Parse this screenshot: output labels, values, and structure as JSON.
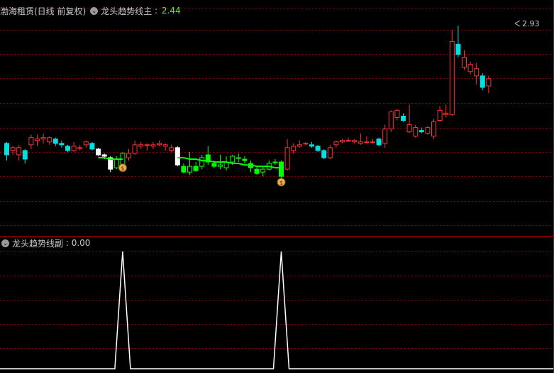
{
  "main_header": {
    "stock_name": "渤海租赁(日线 前复权)",
    "indicator_name": "龙头趋势线主",
    "indicator_value": "2.44",
    "value_color": "#33ff33"
  },
  "sub_header": {
    "indicator_name": "龙头趋势线副",
    "indicator_value": "0.00"
  },
  "price_marker": "2.93",
  "colors": {
    "up": "#ff3232",
    "down": "#00e0e0",
    "trend_up": "#ffffff",
    "trend_down": "#00ff00",
    "grid": "#8b0000",
    "signal": "#ffffff"
  },
  "chart_data": [
    {
      "type": "candlestick",
      "ylim": [
        1.5,
        3.0
      ],
      "last_high_label": "2.93",
      "candles": [
        {
          "o": 2.03,
          "c": 2.11,
          "h": 2.12,
          "l": 1.99,
          "s": "down"
        },
        {
          "o": 2.06,
          "c": 2.08,
          "h": 2.09,
          "l": 2.03,
          "s": "up"
        },
        {
          "o": 2.03,
          "c": 2.08,
          "h": 2.1,
          "l": 1.99,
          "s": "up"
        },
        {
          "o": 2.06,
          "c": 2.0,
          "h": 2.07,
          "l": 1.97,
          "s": "down"
        },
        {
          "o": 2.1,
          "c": 2.15,
          "h": 2.17,
          "l": 2.07,
          "s": "up"
        },
        {
          "o": 2.13,
          "c": 2.14,
          "h": 2.17,
          "l": 2.09,
          "s": "up"
        },
        {
          "o": 2.15,
          "c": 2.14,
          "h": 2.18,
          "l": 2.11,
          "s": "up"
        },
        {
          "o": 2.12,
          "c": 2.15,
          "h": 2.16,
          "l": 2.1,
          "s": "up"
        },
        {
          "o": 2.14,
          "c": 2.11,
          "h": 2.15,
          "l": 2.09,
          "s": "down"
        },
        {
          "o": 2.11,
          "c": 2.1,
          "h": 2.13,
          "l": 2.08,
          "s": "down"
        },
        {
          "o": 2.09,
          "c": 2.06,
          "h": 2.1,
          "l": 2.05,
          "s": "down"
        },
        {
          "o": 2.06,
          "c": 2.09,
          "h": 2.12,
          "l": 2.05,
          "s": "up"
        },
        {
          "o": 2.08,
          "c": 2.08,
          "h": 2.1,
          "l": 2.06,
          "s": "up"
        },
        {
          "o": 2.1,
          "c": 2.12,
          "h": 2.13,
          "l": 2.08,
          "s": "up"
        },
        {
          "o": 2.11,
          "c": 2.07,
          "h": 2.12,
          "l": 2.06,
          "s": "down"
        },
        {
          "o": 2.07,
          "c": 2.03,
          "h": 2.08,
          "l": 2.02,
          "s": "trend_up_down"
        },
        {
          "o": 2.03,
          "c": 2.02,
          "h": 2.04,
          "l": 2.0,
          "s": "trend_up_down"
        },
        {
          "o": 2.01,
          "c": 1.93,
          "h": 2.02,
          "l": 1.91,
          "s": "trend_up_down"
        },
        {
          "o": 1.94,
          "c": 2.0,
          "h": 2.02,
          "l": 1.93,
          "s": "trend_down_up"
        },
        {
          "o": 1.96,
          "c": 2.04,
          "h": 2.05,
          "l": 1.92,
          "s": "trend_down_up"
        },
        {
          "o": 2.01,
          "c": 2.04,
          "h": 2.07,
          "l": 1.99,
          "s": "up"
        },
        {
          "o": 2.04,
          "c": 2.1,
          "h": 2.13,
          "l": 2.03,
          "s": "up"
        },
        {
          "o": 2.09,
          "c": 2.1,
          "h": 2.12,
          "l": 2.07,
          "s": "up"
        },
        {
          "o": 2.1,
          "c": 2.1,
          "h": 2.11,
          "l": 2.06,
          "s": "up"
        },
        {
          "o": 2.09,
          "c": 2.1,
          "h": 2.12,
          "l": 2.07,
          "s": "up"
        },
        {
          "o": 2.1,
          "c": 2.11,
          "h": 2.13,
          "l": 2.09,
          "s": "up"
        },
        {
          "o": 2.1,
          "c": 2.09,
          "h": 2.11,
          "l": 2.06,
          "s": "up"
        },
        {
          "o": 2.08,
          "c": 2.06,
          "h": 2.1,
          "l": 2.05,
          "s": "up"
        },
        {
          "o": 2.08,
          "c": 1.96,
          "h": 2.09,
          "l": 1.95,
          "s": "trend_up_down"
        },
        {
          "o": 1.95,
          "c": 1.91,
          "h": 1.97,
          "l": 1.9,
          "s": "trend_down_down"
        },
        {
          "o": 1.91,
          "c": 1.95,
          "h": 2.05,
          "l": 1.89,
          "s": "trend_down_up"
        },
        {
          "o": 1.92,
          "c": 1.95,
          "h": 1.98,
          "l": 1.91,
          "s": "trend_down_down"
        },
        {
          "o": 1.95,
          "c": 2.01,
          "h": 2.03,
          "l": 1.93,
          "s": "trend_down_up"
        },
        {
          "o": 2.03,
          "c": 1.98,
          "h": 2.09,
          "l": 1.96,
          "s": "trend_down_down"
        },
        {
          "o": 1.97,
          "c": 1.95,
          "h": 1.99,
          "l": 1.94,
          "s": "trend_down_down"
        },
        {
          "o": 1.95,
          "c": 1.96,
          "h": 2.03,
          "l": 1.93,
          "s": "trend_down_up"
        },
        {
          "o": 1.94,
          "c": 1.98,
          "h": 2.02,
          "l": 1.92,
          "s": "trend_down_up"
        },
        {
          "o": 1.98,
          "c": 2.02,
          "h": 2.03,
          "l": 1.96,
          "s": "trend_down_up"
        },
        {
          "o": 2.01,
          "c": 2.01,
          "h": 2.04,
          "l": 1.98,
          "s": "trend_down_down"
        },
        {
          "o": 2.0,
          "c": 1.99,
          "h": 2.02,
          "l": 1.97,
          "s": "trend_down_down"
        },
        {
          "o": 1.97,
          "c": 1.94,
          "h": 1.99,
          "l": 1.91,
          "s": "trend_down_down"
        },
        {
          "o": 1.93,
          "c": 1.9,
          "h": 1.95,
          "l": 1.89,
          "s": "trend_down_down"
        },
        {
          "o": 1.91,
          "c": 1.93,
          "h": 1.95,
          "l": 1.88,
          "s": "trend_down_up"
        },
        {
          "o": 1.93,
          "c": 1.97,
          "h": 1.99,
          "l": 1.92,
          "s": "trend_down_up"
        },
        {
          "o": 1.98,
          "c": 1.98,
          "h": 2.0,
          "l": 1.96,
          "s": "trend_down_up"
        },
        {
          "o": 1.98,
          "c": 1.88,
          "h": 1.99,
          "l": 1.87,
          "s": "trend_down_down"
        },
        {
          "o": 1.93,
          "c": 2.08,
          "h": 2.14,
          "l": 1.92,
          "s": "up"
        },
        {
          "o": 2.06,
          "c": 2.09,
          "h": 2.11,
          "l": 2.04,
          "s": "up"
        },
        {
          "o": 2.09,
          "c": 2.1,
          "h": 2.13,
          "l": 2.08,
          "s": "up"
        },
        {
          "o": 2.11,
          "c": 2.11,
          "h": 2.12,
          "l": 2.1,
          "s": "up"
        },
        {
          "o": 2.1,
          "c": 2.09,
          "h": 2.12,
          "l": 2.08,
          "s": "down"
        },
        {
          "o": 2.09,
          "c": 2.06,
          "h": 2.1,
          "l": 2.05,
          "s": "down"
        },
        {
          "o": 2.06,
          "c": 2.01,
          "h": 2.07,
          "l": 2.0,
          "s": "down"
        },
        {
          "o": 2.01,
          "c": 2.08,
          "h": 2.1,
          "l": 2.0,
          "s": "up"
        },
        {
          "o": 2.1,
          "c": 2.12,
          "h": 2.13,
          "l": 2.08,
          "s": "up"
        },
        {
          "o": 2.12,
          "c": 2.13,
          "h": 2.14,
          "l": 2.11,
          "s": "up"
        },
        {
          "o": 2.13,
          "c": 2.13,
          "h": 2.15,
          "l": 2.12,
          "s": "up"
        },
        {
          "o": 2.13,
          "c": 2.12,
          "h": 2.14,
          "l": 2.11,
          "s": "up"
        },
        {
          "o": 2.11,
          "c": 2.12,
          "h": 2.18,
          "l": 2.1,
          "s": "up"
        },
        {
          "o": 2.12,
          "c": 2.12,
          "h": 2.16,
          "l": 2.11,
          "s": "up"
        },
        {
          "o": 2.12,
          "c": 2.12,
          "h": 2.14,
          "l": 2.11,
          "s": "up"
        },
        {
          "o": 2.14,
          "c": 2.1,
          "h": 2.15,
          "l": 2.09,
          "s": "down"
        },
        {
          "o": 2.11,
          "c": 2.21,
          "h": 2.24,
          "l": 2.08,
          "s": "up"
        },
        {
          "o": 2.21,
          "c": 2.33,
          "h": 2.34,
          "l": 2.19,
          "s": "up"
        },
        {
          "o": 2.34,
          "c": 2.29,
          "h": 2.35,
          "l": 2.27,
          "s": "up"
        },
        {
          "o": 2.3,
          "c": 2.27,
          "h": 2.32,
          "l": 2.26,
          "s": "down"
        },
        {
          "o": 2.24,
          "c": 2.19,
          "h": 2.38,
          "l": 2.18,
          "s": "up"
        },
        {
          "o": 2.22,
          "c": 2.16,
          "h": 2.24,
          "l": 2.15,
          "s": "up"
        },
        {
          "o": 2.2,
          "c": 2.19,
          "h": 2.22,
          "l": 2.18,
          "s": "down"
        },
        {
          "o": 2.22,
          "c": 2.18,
          "h": 2.23,
          "l": 2.17,
          "s": "up"
        },
        {
          "o": 2.16,
          "c": 2.26,
          "h": 2.28,
          "l": 2.14,
          "s": "up"
        },
        {
          "o": 2.27,
          "c": 2.34,
          "h": 2.37,
          "l": 2.26,
          "s": "up"
        },
        {
          "o": 2.32,
          "c": 2.31,
          "h": 2.38,
          "l": 2.29,
          "s": "up"
        },
        {
          "o": 2.31,
          "c": 2.82,
          "h": 2.9,
          "l": 2.3,
          "s": "up"
        },
        {
          "o": 2.8,
          "c": 2.73,
          "h": 2.93,
          "l": 2.71,
          "s": "down"
        },
        {
          "o": 2.71,
          "c": 2.64,
          "h": 2.76,
          "l": 2.62,
          "s": "up"
        },
        {
          "o": 2.66,
          "c": 2.61,
          "h": 2.68,
          "l": 2.59,
          "s": "up"
        },
        {
          "o": 2.63,
          "c": 2.58,
          "h": 2.67,
          "l": 2.52,
          "s": "up"
        },
        {
          "o": 2.58,
          "c": 2.5,
          "h": 2.6,
          "l": 2.48,
          "s": "down"
        },
        {
          "o": 2.56,
          "c": 2.51,
          "h": 2.58,
          "l": 2.46,
          "s": "up"
        }
      ],
      "trend_line": [
        {
          "i": 15,
          "v": 2.01
        },
        {
          "i": 16,
          "v": 2.01
        },
        {
          "i": 17,
          "v": 2.0
        },
        {
          "i": 18,
          "v": 2.0
        },
        {
          "i": 19,
          "v": 2.0
        },
        {
          "i": 28,
          "v": 2.01
        },
        {
          "i": 29,
          "v": 2.01
        },
        {
          "i": 30,
          "v": 2.0
        },
        {
          "i": 31,
          "v": 2.0
        },
        {
          "i": 32,
          "v": 1.99
        },
        {
          "i": 33,
          "v": 1.99
        },
        {
          "i": 34,
          "v": 1.98
        },
        {
          "i": 35,
          "v": 1.98
        },
        {
          "i": 36,
          "v": 1.98
        },
        {
          "i": 37,
          "v": 1.97
        },
        {
          "i": 38,
          "v": 1.97
        },
        {
          "i": 39,
          "v": 1.96
        },
        {
          "i": 40,
          "v": 1.96
        },
        {
          "i": 41,
          "v": 1.95
        },
        {
          "i": 42,
          "v": 1.95
        },
        {
          "i": 43,
          "v": 1.95
        },
        {
          "i": 44,
          "v": 1.94
        },
        {
          "i": 45,
          "v": 1.94
        }
      ],
      "signal_markers": [
        {
          "i": 19,
          "v": 1.94
        },
        {
          "i": 45,
          "v": 1.84
        }
      ]
    },
    {
      "type": "line",
      "name": "龙头趋势线副",
      "ylim": [
        0,
        1
      ],
      "values_by_bar": {
        "peaks": [
          19,
          45
        ]
      },
      "series": [
        {
          "values": [
            0,
            0,
            0,
            0,
            0,
            0,
            0,
            0,
            0,
            0,
            0,
            0,
            0,
            0,
            0,
            0,
            0,
            0,
            0,
            1,
            0,
            0,
            0,
            0,
            0,
            0,
            0,
            0,
            0,
            0,
            0,
            0,
            0,
            0,
            0,
            0,
            0,
            0,
            0,
            0,
            0,
            0,
            0,
            0,
            0,
            1,
            0,
            0,
            0,
            0,
            0,
            0,
            0,
            0,
            0,
            0,
            0,
            0,
            0,
            0,
            0,
            0,
            0,
            0,
            0,
            0,
            0,
            0,
            0,
            0,
            0,
            0,
            0,
            0,
            0,
            0,
            0,
            0,
            0,
            0,
            0
          ]
        }
      ]
    }
  ]
}
